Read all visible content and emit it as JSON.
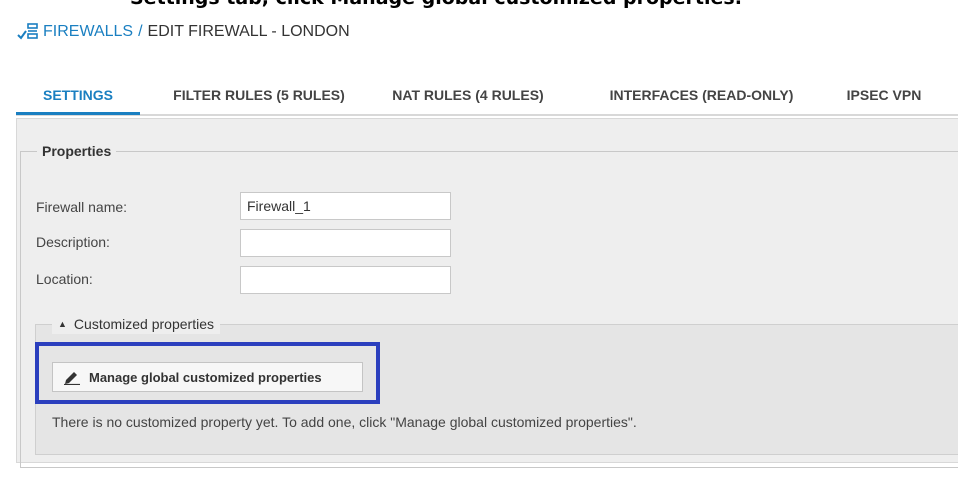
{
  "instruction": {
    "text": "Settings tab, click Manage global customized properties."
  },
  "breadcrumb": {
    "icon": "firewall-list-icon",
    "parent": "FIREWALLS",
    "separator": "/",
    "current": "EDIT FIREWALL - LONDON"
  },
  "tabs": [
    {
      "label": "SETTINGS",
      "active": true
    },
    {
      "label": "FILTER RULES (5 RULES)",
      "active": false
    },
    {
      "label": "NAT RULES (4 RULES)",
      "active": false
    },
    {
      "label": "INTERFACES (READ-ONLY)",
      "active": false
    },
    {
      "label": "IPSEC VPN",
      "active": false
    }
  ],
  "properties": {
    "legend": "Properties",
    "fields": [
      {
        "label": "Firewall name:",
        "value": "Firewall_1"
      },
      {
        "label": "Description:",
        "value": ""
      },
      {
        "label": "Location:",
        "value": ""
      }
    ]
  },
  "customized": {
    "legend": "Customized properties",
    "toggle_icon": "triangle-up-icon",
    "button_label": "Manage global customized properties",
    "button_icon": "pencil-icon",
    "empty_message": "There is no customized property yet. To add one, click \"Manage global customized properties\"."
  },
  "colors": {
    "accent": "#1a7fc1",
    "highlight": "#2b3fbe",
    "panel_bg": "#eeeeee"
  }
}
